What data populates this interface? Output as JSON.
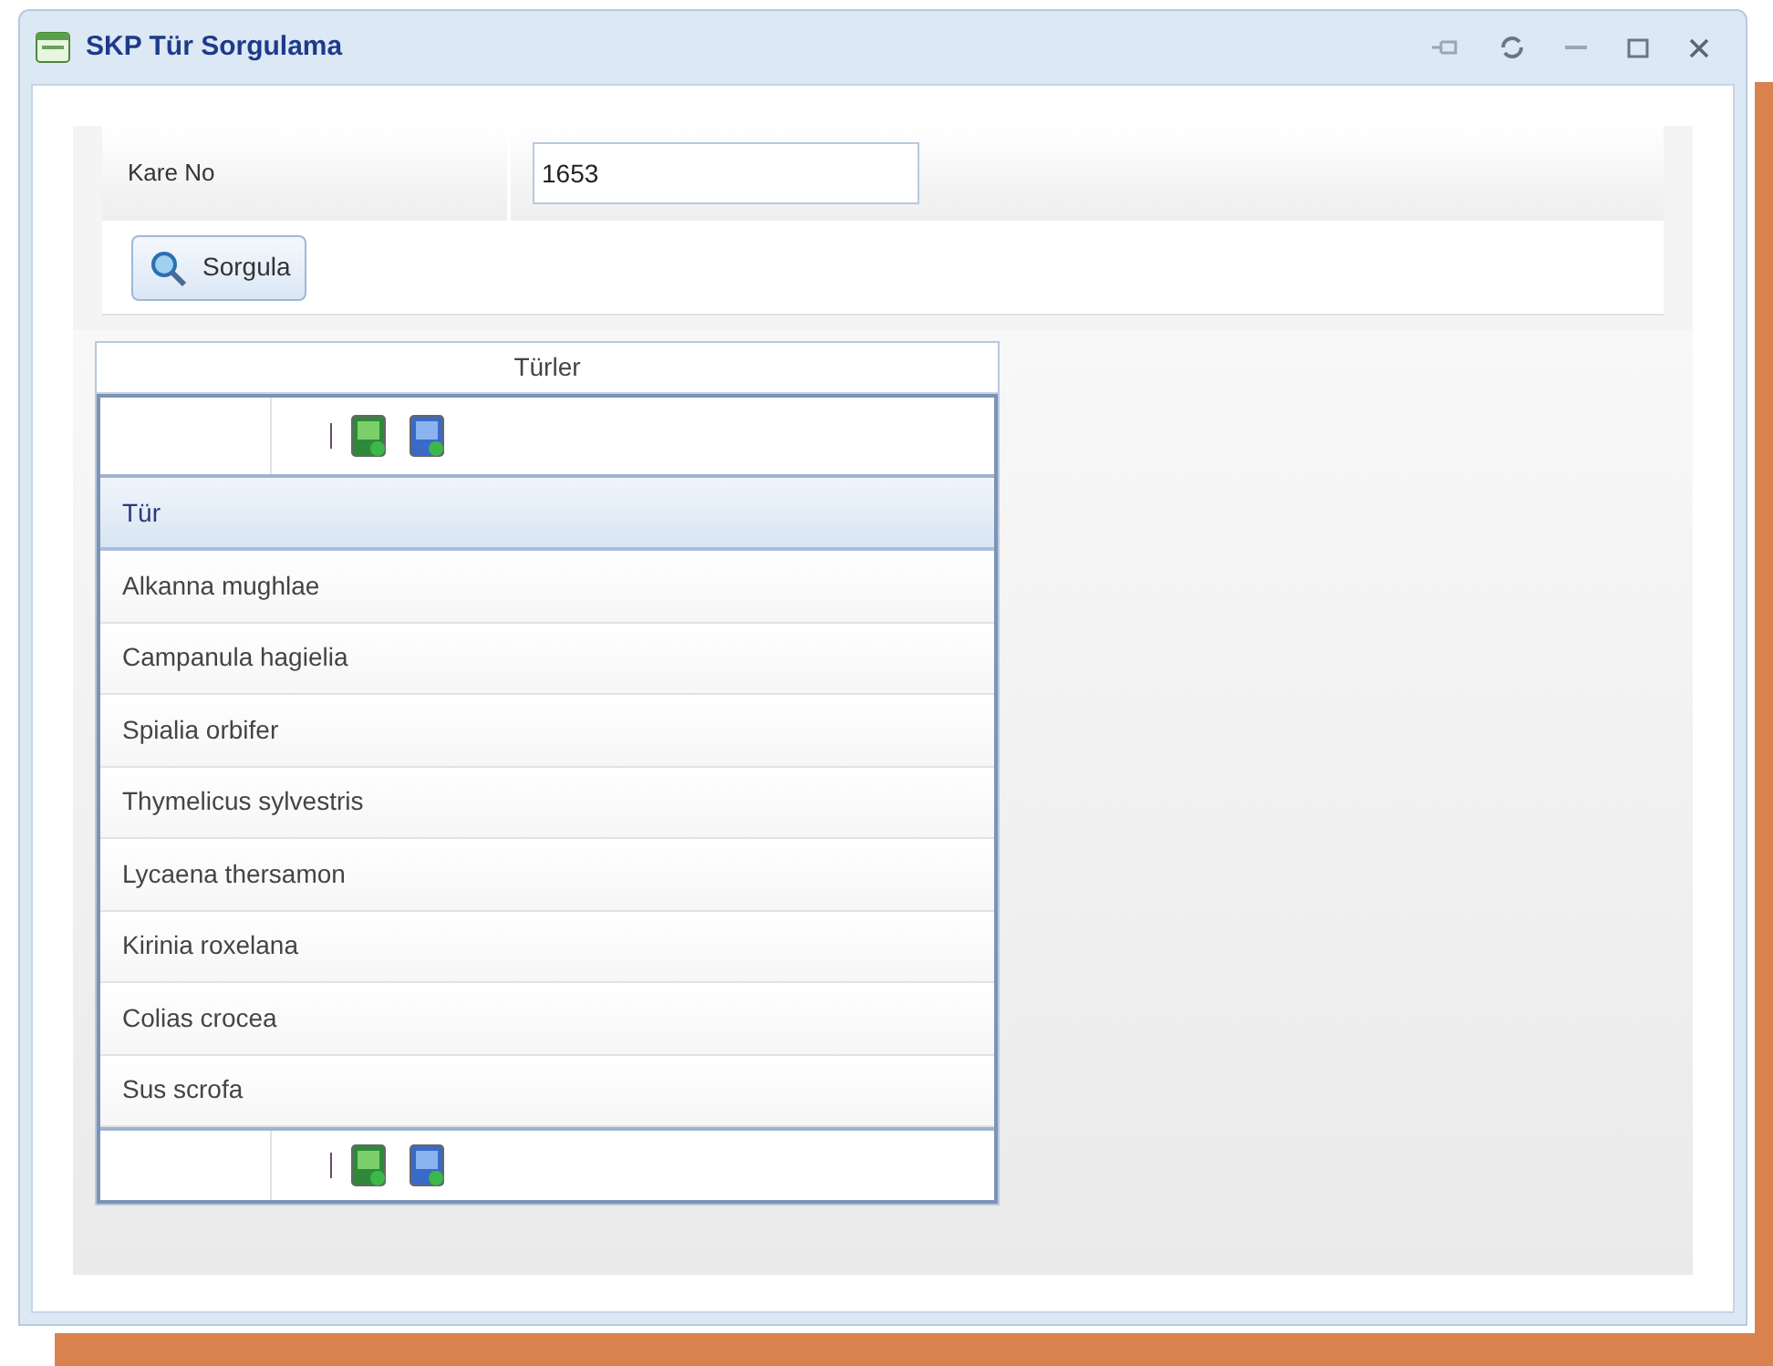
{
  "window": {
    "title": "SKP Tür Sorgulama"
  },
  "form": {
    "label": "Kare No",
    "value": "1653",
    "button": "Sorgula"
  },
  "table": {
    "title": "Türler",
    "column": "Tür",
    "rows": [
      "Alkanna mughlae",
      "Campanula hagielia",
      "Spialia orbifer",
      "Thymelicus sylvestris",
      "Lycaena thersamon",
      "Kirinia roxelana",
      "Colias crocea",
      "Sus scrofa"
    ]
  }
}
